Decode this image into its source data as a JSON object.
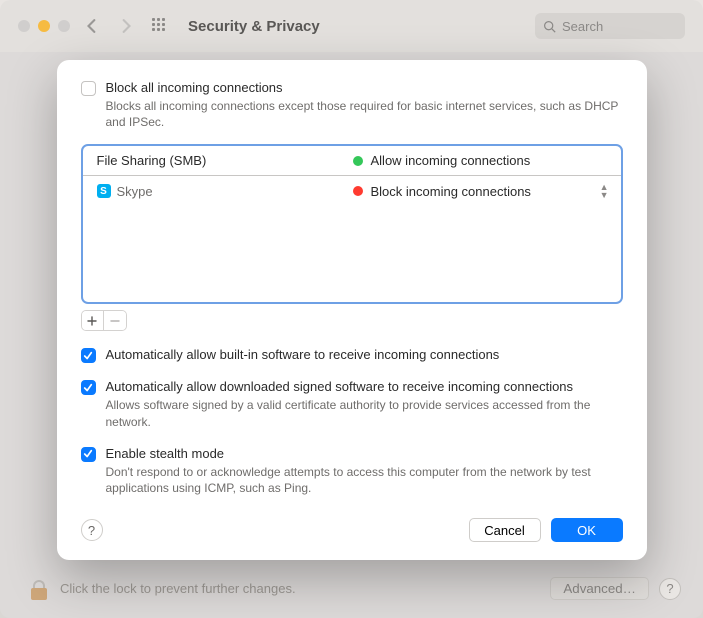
{
  "window": {
    "title": "Security & Privacy",
    "search_placeholder": "Search"
  },
  "sheet": {
    "block_all": {
      "checked": false,
      "label": "Block all incoming connections",
      "desc": "Blocks all incoming connections except those required for basic internet services, such as DHCP and IPSec."
    },
    "apps": [
      {
        "name": "File Sharing (SMB)",
        "icon": null,
        "status_label": "Allow incoming connections",
        "status_color": "green",
        "editable": false
      },
      {
        "name": "Skype",
        "icon": "skype",
        "status_label": "Block incoming connections",
        "status_color": "red",
        "editable": true
      }
    ],
    "opt_builtin": {
      "checked": true,
      "label": "Automatically allow built-in software to receive incoming connections"
    },
    "opt_signed": {
      "checked": true,
      "label": "Automatically allow downloaded signed software to receive incoming connections",
      "desc": "Allows software signed by a valid certificate authority to provide services accessed from the network."
    },
    "opt_stealth": {
      "checked": true,
      "label": "Enable stealth mode",
      "desc": "Don't respond to or acknowledge attempts to access this computer from the network by test applications using ICMP, such as Ping."
    },
    "buttons": {
      "cancel": "Cancel",
      "ok": "OK"
    }
  },
  "parent_footer": {
    "lock_text": "Click the lock to prevent further changes.",
    "advanced": "Advanced…"
  }
}
